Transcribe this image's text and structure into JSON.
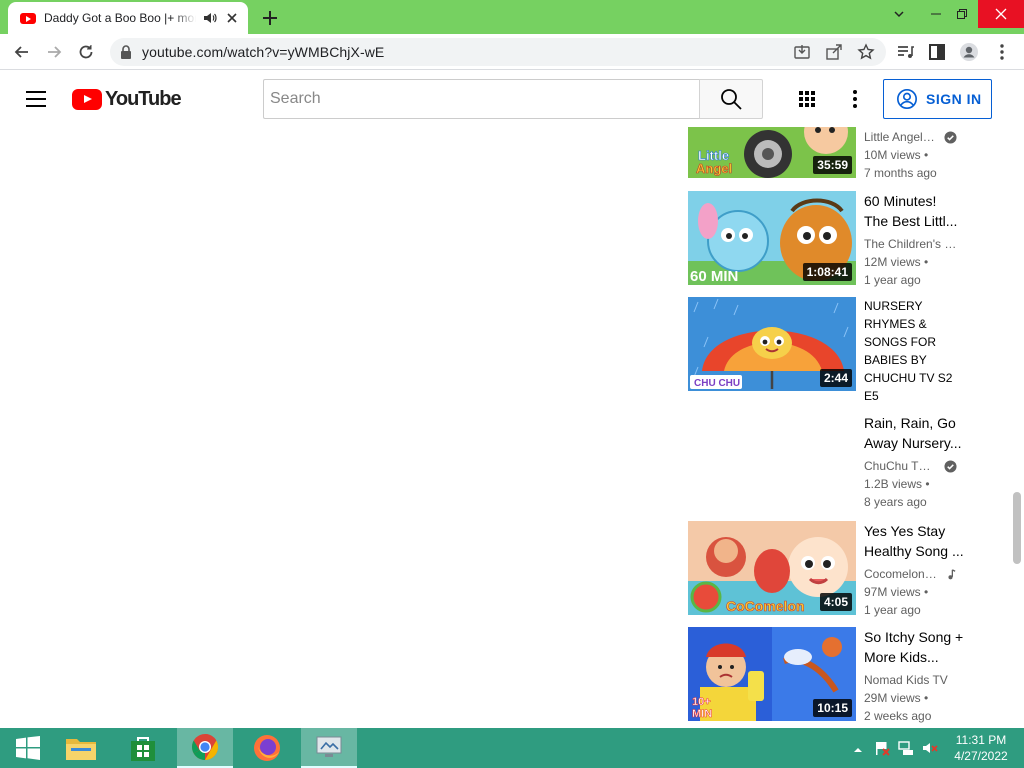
{
  "browser": {
    "tab_title": "Daddy Got a Boo Boo |+ more",
    "url": "youtube.com/watch?v=yWMBChjX-wE"
  },
  "youtube": {
    "logo_text": "YouTube",
    "search_placeholder": "Search",
    "signin_label": "SIGN IN"
  },
  "recommendations": [
    {
      "title": "",
      "channel": "Little Angel: ...",
      "verified": true,
      "views": "10M views •",
      "age": "7 months ago",
      "duration": "35:59",
      "thumb_label": "Little Angel"
    },
    {
      "title": "60 Minutes! The Best Littl...",
      "channel": "The Children's Ki...",
      "verified": false,
      "views": "12M views •",
      "age": "1 year ago",
      "duration": "1:08:41",
      "thumb_label": "60 MIN"
    },
    {
      "title": "NURSERY RHYMES & SONGS FOR BABIES BY CHUCHU TV  S2 E5",
      "channel": "",
      "verified": false,
      "views": "",
      "age": "",
      "duration": "2:44",
      "thumb_label": "CHU CHU"
    },
    {
      "title": "Rain, Rain, Go Away Nursery...",
      "channel": "ChuChu TV ...",
      "verified": true,
      "views": "1.2B views •",
      "age": "8 years ago",
      "duration": "",
      "thumb_label": ""
    },
    {
      "title": "Yes Yes Stay Healthy Song ...",
      "channel": "Cocomelon ...",
      "verified": false,
      "music": true,
      "views": "97M views •",
      "age": "1 year ago",
      "duration": "4:05",
      "thumb_label": "CoComelon"
    },
    {
      "title": "So Itchy Song + More Kids...",
      "channel": "Nomad Kids TV",
      "verified": false,
      "views": "29M views •",
      "age": "2 weeks ago",
      "duration": "10:15",
      "thumb_label": "10+ MIN"
    }
  ],
  "taskbar": {
    "time": "11:31 PM",
    "date": "4/27/2022"
  },
  "colors": {
    "tabbar": "#76d161",
    "taskbar": "#2f9c80",
    "youtube_red": "#ff0000",
    "signin_blue": "#065fd4"
  }
}
